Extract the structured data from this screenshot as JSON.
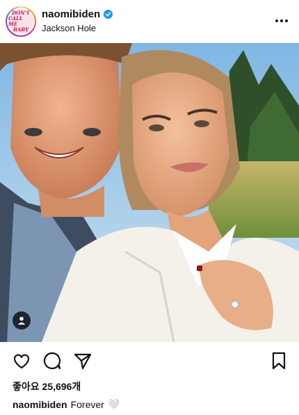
{
  "post": {
    "username": "naomibiden",
    "location": "Jackson Hole",
    "avatar_text": [
      "DON'T",
      "CALL ME",
      "BABY"
    ],
    "likes_label": "좋아요",
    "likes_count": "25,696개",
    "caption_username": "naomibiden",
    "caption_text": "Forever",
    "caption_emoji": "🤍"
  },
  "icons": {
    "verified": "verified-badge-icon",
    "more": "more-options-icon",
    "tag": "tagged-user-icon",
    "like": "heart-icon",
    "comment": "comment-icon",
    "share": "send-icon",
    "save": "bookmark-icon"
  },
  "colors": {
    "verified": "#1d9bf0",
    "avatar_ring": "#d62976"
  }
}
